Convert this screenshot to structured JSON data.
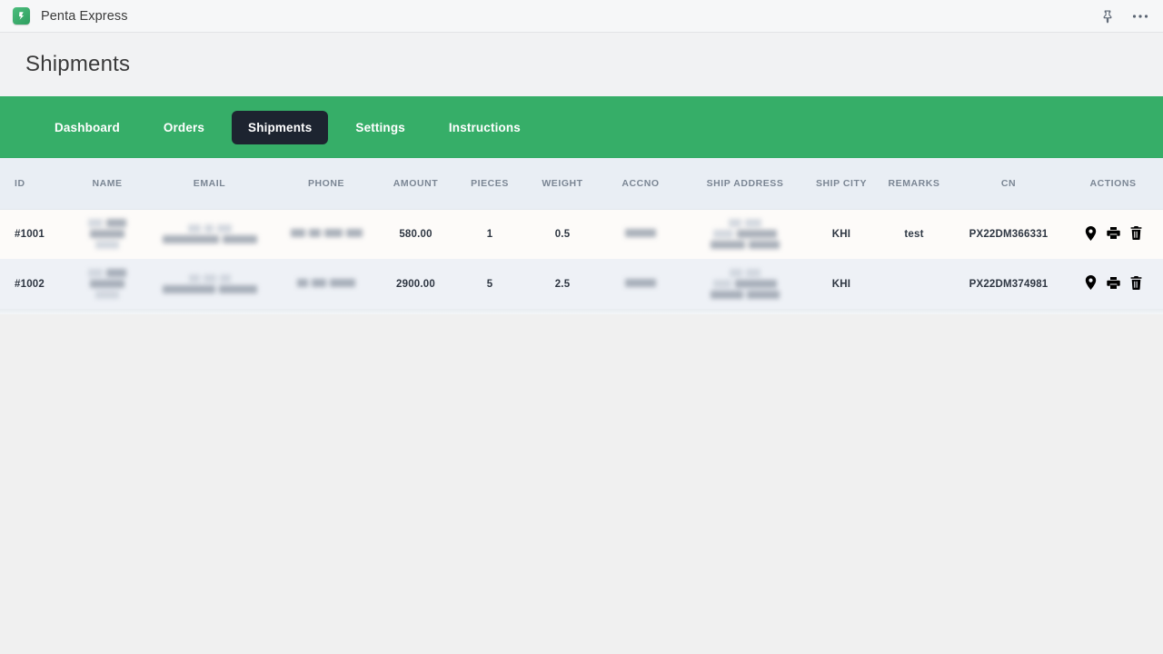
{
  "window": {
    "app_title": "Penta Express",
    "app_icon": "penta-logo-icon",
    "actions": [
      {
        "name": "pin-icon",
        "label": "Pin"
      },
      {
        "name": "more-icon",
        "label": "More options"
      }
    ]
  },
  "page": {
    "title": "Shipments"
  },
  "nav": {
    "active": "Shipments",
    "items": [
      {
        "label": "Dashboard"
      },
      {
        "label": "Orders"
      },
      {
        "label": "Shipments"
      },
      {
        "label": "Settings"
      },
      {
        "label": "Instructions"
      }
    ]
  },
  "table": {
    "columns": [
      {
        "key": "id",
        "label": "ID"
      },
      {
        "key": "name",
        "label": "NAME"
      },
      {
        "key": "email",
        "label": "EMAIL"
      },
      {
        "key": "phone",
        "label": "PHONE"
      },
      {
        "key": "amount",
        "label": "AMOUNT"
      },
      {
        "key": "pieces",
        "label": "PIECES"
      },
      {
        "key": "weight",
        "label": "WEIGHT"
      },
      {
        "key": "accno",
        "label": "ACCNO"
      },
      {
        "key": "ship_address",
        "label": "SHIP ADDRESS"
      },
      {
        "key": "ship_city",
        "label": "SHIP CITY"
      },
      {
        "key": "remarks",
        "label": "REMARKS"
      },
      {
        "key": "cn",
        "label": "CN"
      },
      {
        "key": "actions",
        "label": "ACTIONS"
      }
    ],
    "rows": [
      {
        "id": "#1001",
        "name": "",
        "email": "",
        "phone": "",
        "amount": "580.00",
        "pieces": "1",
        "weight": "0.5",
        "accno": "",
        "ship_address": "",
        "ship_city": "KHI",
        "remarks": "test",
        "cn": "PX22DM366331",
        "redacted": [
          "name",
          "email",
          "phone",
          "accno",
          "ship_address"
        ],
        "actions": [
          {
            "name": "track-location-icon",
            "label": "Track"
          },
          {
            "name": "print-icon",
            "label": "Print"
          },
          {
            "name": "delete-icon",
            "label": "Delete"
          }
        ]
      },
      {
        "id": "#1002",
        "name": "",
        "email": "",
        "phone": "",
        "amount": "2900.00",
        "pieces": "5",
        "weight": "2.5",
        "accno": "",
        "ship_address": "",
        "ship_city": "KHI",
        "remarks": "",
        "cn": "PX22DM374981",
        "redacted": [
          "name",
          "email",
          "phone",
          "accno",
          "ship_address"
        ],
        "actions": [
          {
            "name": "track-location-icon",
            "label": "Track"
          },
          {
            "name": "print-icon",
            "label": "Print"
          },
          {
            "name": "delete-icon",
            "label": "Delete"
          }
        ]
      }
    ]
  },
  "colors": {
    "brand_green": "#36ae68",
    "nav_active_bg": "#1d2430",
    "header_row_bg": "#e9eef4",
    "row_odd_bg": "#fdfbf9",
    "row_even_bg": "#eef1f6",
    "page_bg": "#f0f0f0",
    "title_text": "#3a3a3a"
  }
}
